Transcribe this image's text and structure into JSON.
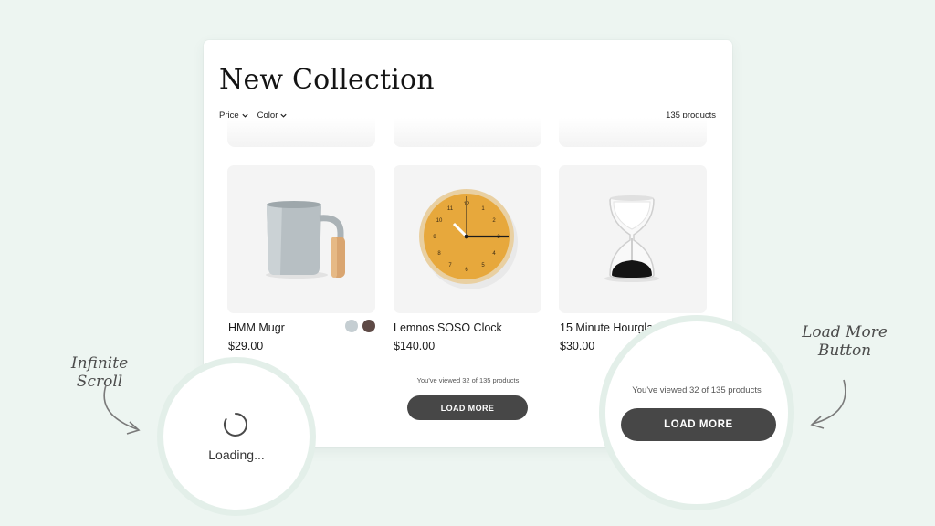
{
  "page": {
    "title": "New Collection",
    "filters": [
      "Price",
      "Color"
    ],
    "product_count": "135 products"
  },
  "products": [
    {
      "name": "HMM Mugr",
      "price": "$29.00",
      "swatches": [
        "#c5ced2",
        "#5e4a46"
      ]
    },
    {
      "name": "Lemnos SOSO Clock",
      "price": "$140.00"
    },
    {
      "name": "15 Minute Hourglass",
      "price": "$30.00"
    }
  ],
  "pagination": {
    "viewed_text": "You've viewed 32 of 135 products",
    "load_more_label": "LOAD MORE"
  },
  "callouts": {
    "infinite_scroll_label": "Infinite Scroll",
    "loading_text": "Loading...",
    "load_more_button_label_line1": "Load More",
    "load_more_button_label_line2": "Button",
    "zoom_viewed_text": "You've viewed 32 of 135 products",
    "zoom_load_more_label": "LOAD MORE"
  },
  "colors": {
    "background": "#edf5f1",
    "button": "#474747",
    "clock_face": "#e7a83c"
  }
}
